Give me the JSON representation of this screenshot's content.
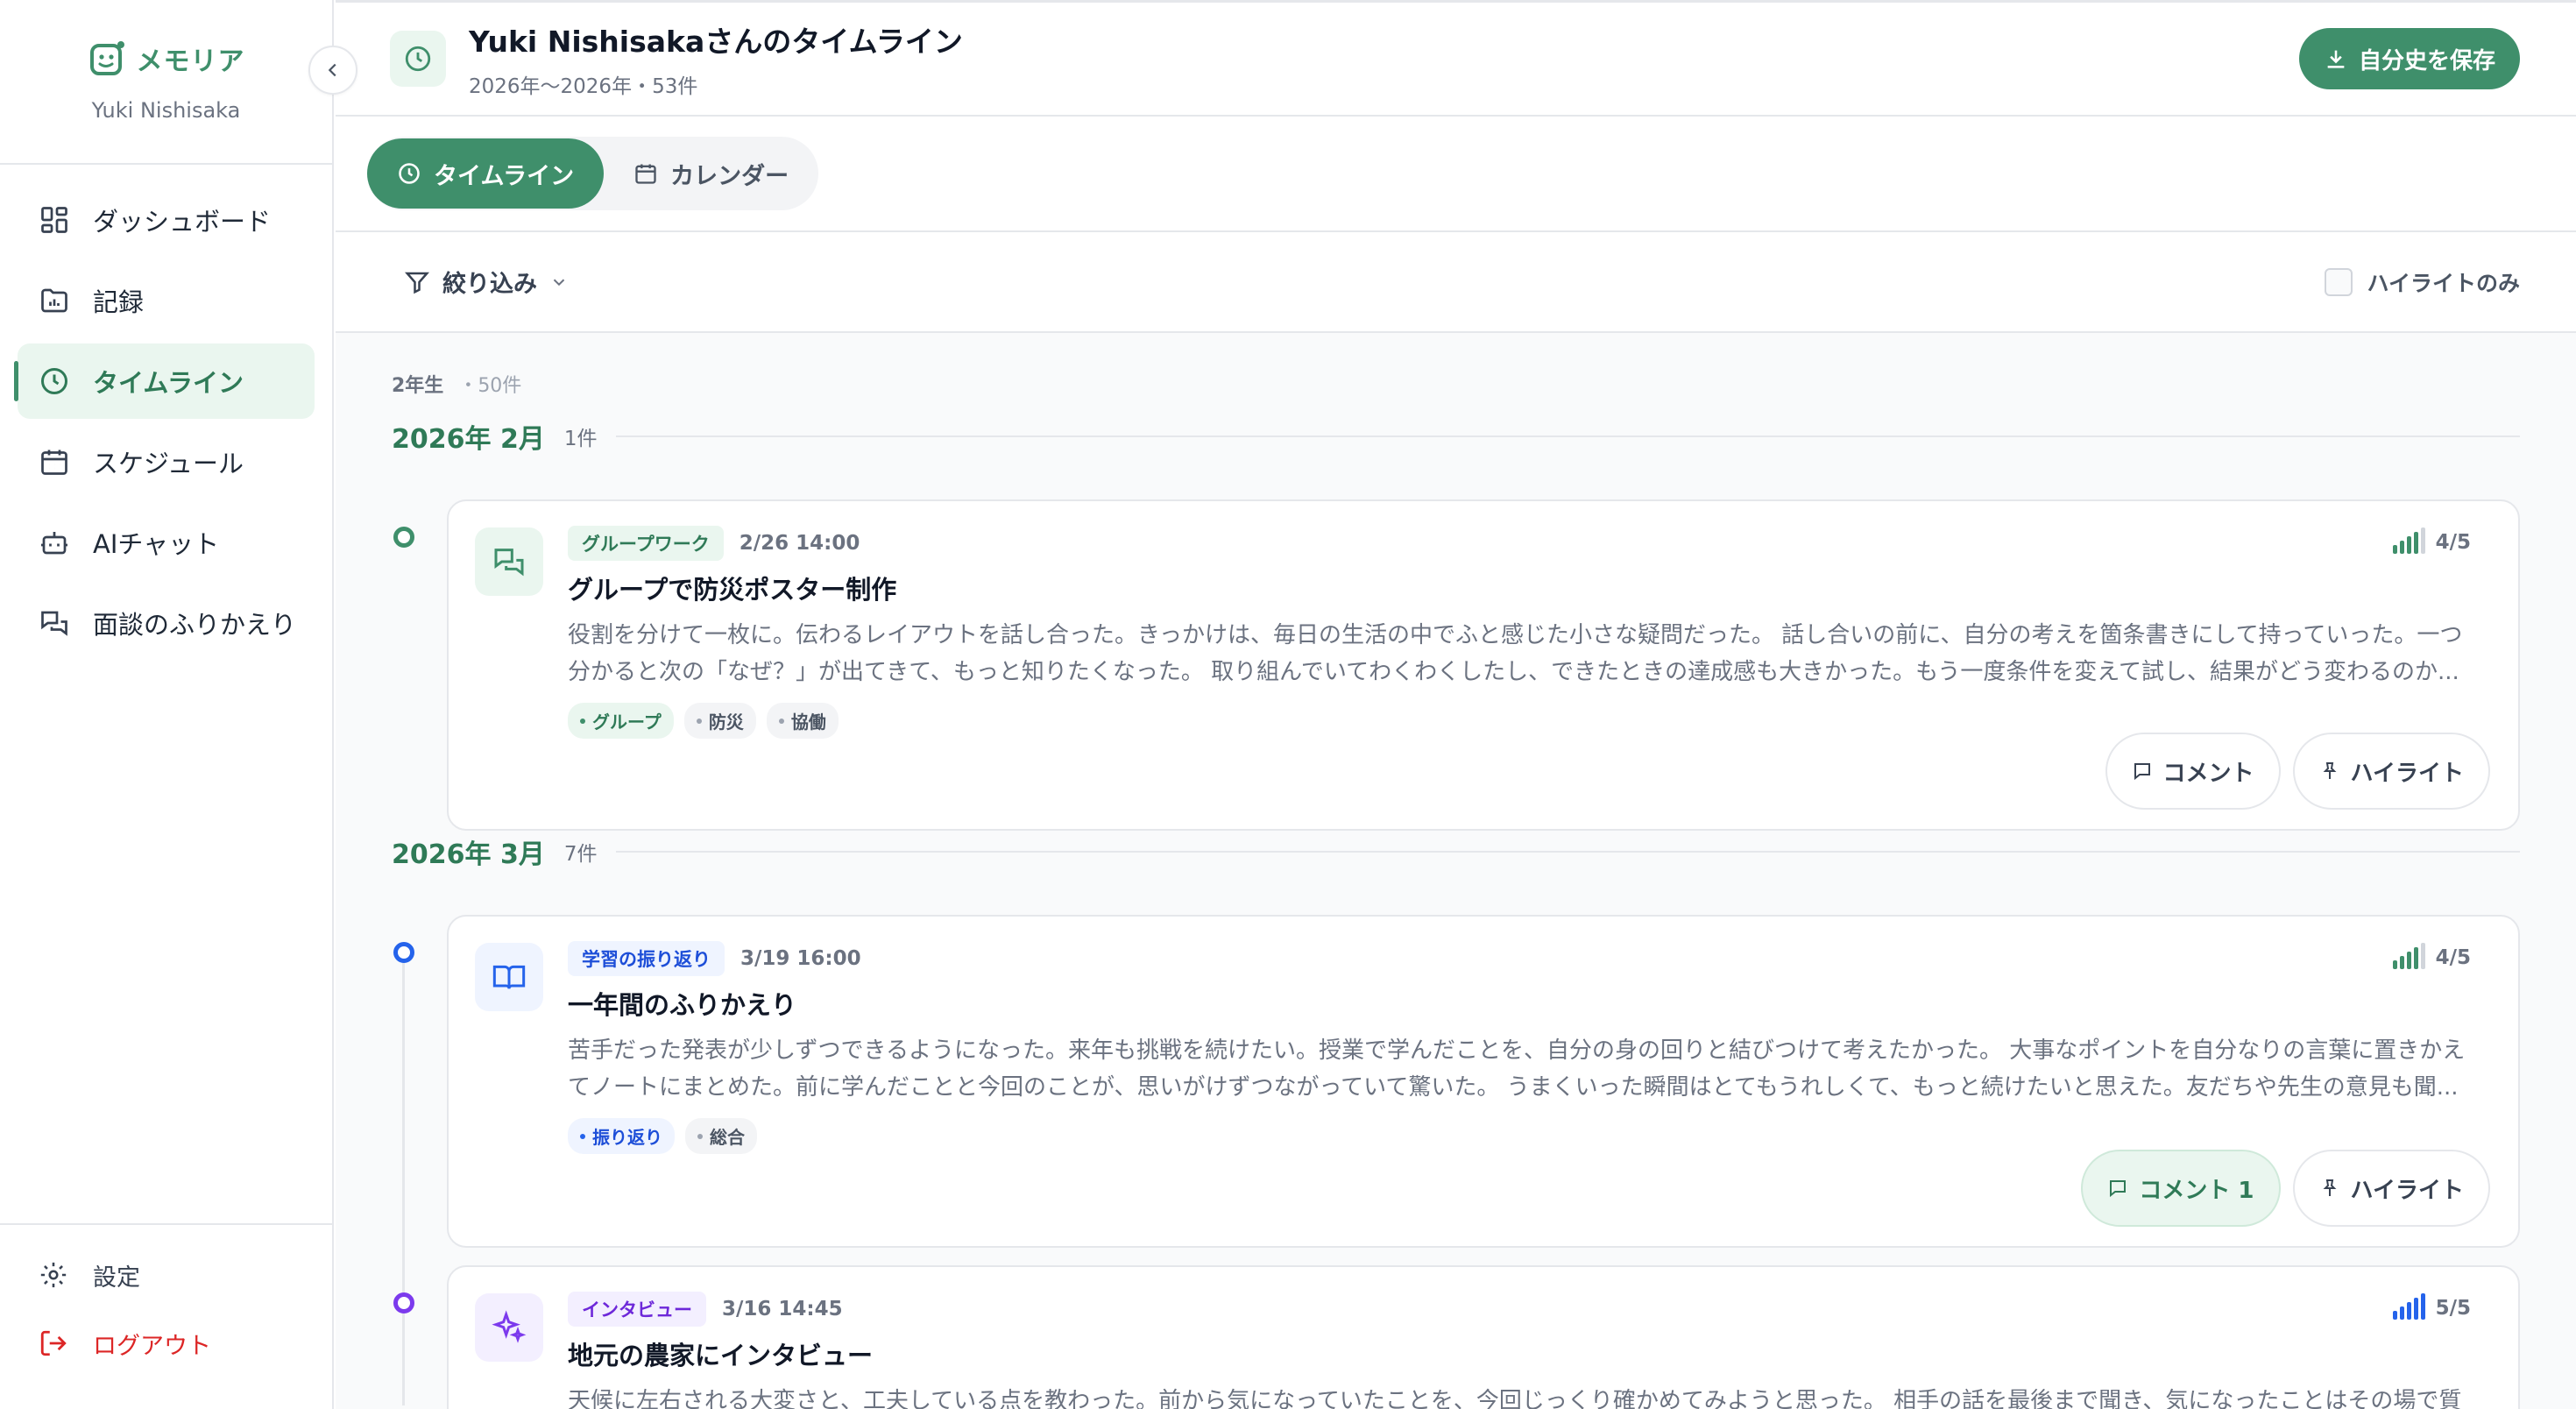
{
  "brand": {
    "name": "メモリア",
    "user": "Yuki Nishisaka"
  },
  "sidebar": {
    "items": [
      {
        "label": "ダッシュボード",
        "icon": "dashboard-icon"
      },
      {
        "label": "記録",
        "icon": "folder-chart-icon"
      },
      {
        "label": "タイムライン",
        "icon": "clock-icon",
        "active": true
      },
      {
        "label": "スケジュール",
        "icon": "calendar-icon"
      },
      {
        "label": "AIチャット",
        "icon": "bot-icon"
      },
      {
        "label": "面談のふりかえり",
        "icon": "chat-bubbles-icon"
      }
    ],
    "settings": "設定",
    "logout": "ログアウト"
  },
  "header": {
    "title": "Yuki Nishisakaさんのタイムライン",
    "subtitle": "2026年〜2026年・53件",
    "save_label": "自分史を保存"
  },
  "tabs": [
    {
      "label": "タイムライン",
      "active": true
    },
    {
      "label": "カレンダー",
      "active": false
    }
  ],
  "filter": {
    "label": "絞り込み",
    "highlight_only": "ハイライトのみ"
  },
  "timeline": {
    "grade": "2年生",
    "grade_count": "・50件",
    "months": [
      {
        "title": "2026年 2月",
        "count": "1件",
        "entries": [
          {
            "category": "グループワーク",
            "time": "2/26 14:00",
            "title": "グループで防災ポスター制作",
            "text": "役割を分けて一枚に。伝わるレイアウトを話し合った。きっかけは、毎日の生活の中でふと感じた小さな疑問だった。 話し合いの前に、自分の考えを箇条書きにして持っていった。一つ分かると次の「なぜ？」が出てきて、もっと知りたくなった。 取り組んでいてわくわくしたし、できたときの達成感も大きかった。もう一度条件を変えて試し、結果がどう変わるのか...",
            "tags": [
              "グループ",
              "防災",
              "協働"
            ],
            "rating": "4/5",
            "rating_value": 4,
            "comment_label": "コメント",
            "highlight_label": "ハイライト"
          }
        ]
      },
      {
        "title": "2026年 3月",
        "count": "7件",
        "entries": [
          {
            "category": "学習の振り返り",
            "time": "3/19 16:00",
            "title": "一年間のふりかえり",
            "text": "苦手だった発表が少しずつできるようになった。来年も挑戦を続けたい。授業で学んだことを、自分の身の回りと結びつけて考えたかった。 大事なポイントを自分なりの言葉に置きかえてノートにまとめた。前に学んだことと今回のことが、思いがけずつながっていて驚いた。 うまくいった瞬間はとてもうれしくて、もっと続けたいと思えた。友だちや先生の意見も聞...",
            "tags": [
              "振り返り",
              "総合"
            ],
            "rating": "4/5",
            "rating_value": 4,
            "comment_label": "コメント 1",
            "highlight_label": "ハイライト"
          },
          {
            "category": "インタビュー",
            "time": "3/16 14:45",
            "title": "地元の農家にインタビュー",
            "text": "天候に左右される大変さと、工夫している点を教わった。前から気になっていたことを、今回じっくり確かめてみようと思った。 相手の話を最後まで聞き、気になったことはその場で質",
            "tags": [],
            "rating": "5/5",
            "rating_value": 5
          }
        ]
      }
    ]
  },
  "colors": {
    "accent": "#3f8f6b",
    "accent_light": "#eaf6ef",
    "group_work": "#3f8f6b",
    "reflection": "#2563eb",
    "interview": "#7c3aed",
    "logout": "#dc2626"
  }
}
